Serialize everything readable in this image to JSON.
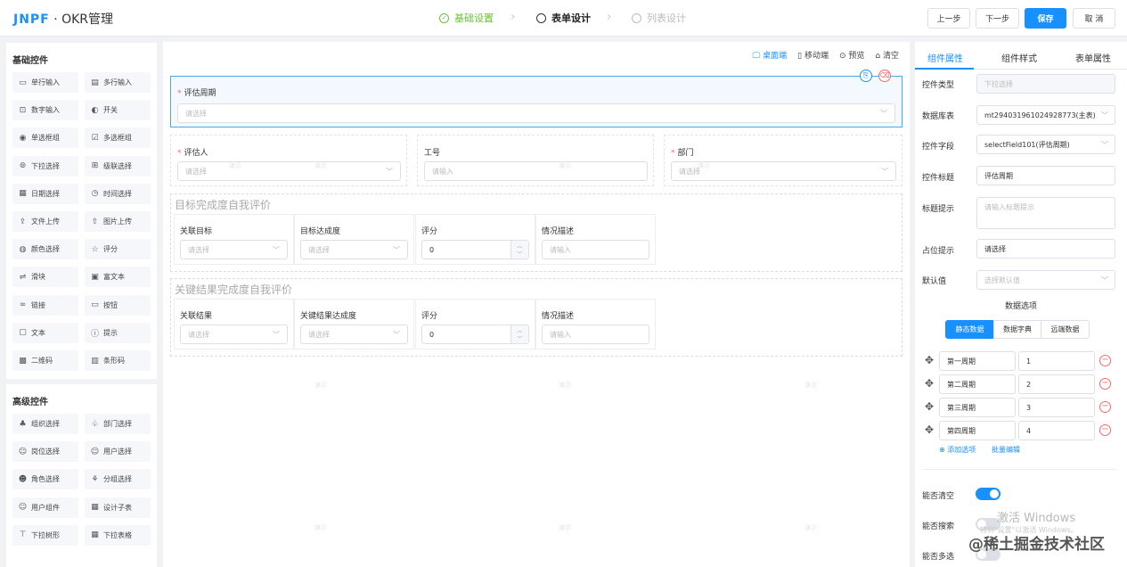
{
  "header": {
    "logo_brand": "JNPF",
    "logo_sep": "·",
    "title": "OKR管理",
    "steps": [
      {
        "label": "基础设置",
        "state": "done"
      },
      {
        "label": "表单设计",
        "state": "active"
      },
      {
        "label": "列表设计",
        "state": "todo"
      }
    ],
    "buttons": {
      "prev": "上一步",
      "next": "下一步",
      "save": "保存",
      "cancel": "取 消"
    }
  },
  "basic_controls": {
    "title": "基础控件",
    "items": [
      {
        "label": "单行输入",
        "icon": "input-icon"
      },
      {
        "label": "多行输入",
        "icon": "textarea-icon"
      },
      {
        "label": "数字输入",
        "icon": "number-icon"
      },
      {
        "label": "开关",
        "icon": "switch-icon"
      },
      {
        "label": "单选框组",
        "icon": "radio-icon"
      },
      {
        "label": "多选框组",
        "icon": "checkbox-icon"
      },
      {
        "label": "下拉选择",
        "icon": "select-icon"
      },
      {
        "label": "级联选择",
        "icon": "cascader-icon"
      },
      {
        "label": "日期选择",
        "icon": "calendar-icon"
      },
      {
        "label": "时间选择",
        "icon": "clock-icon"
      },
      {
        "label": "文件上传",
        "icon": "upload-icon"
      },
      {
        "label": "图片上传",
        "icon": "image-upload-icon"
      },
      {
        "label": "颜色选择",
        "icon": "palette-icon"
      },
      {
        "label": "评分",
        "icon": "star-icon"
      },
      {
        "label": "滑块",
        "icon": "slider-icon"
      },
      {
        "label": "富文本",
        "icon": "richtext-icon"
      },
      {
        "label": "链接",
        "icon": "link-icon"
      },
      {
        "label": "按钮",
        "icon": "button-icon"
      },
      {
        "label": "文本",
        "icon": "text-icon"
      },
      {
        "label": "提示",
        "icon": "alert-icon"
      },
      {
        "label": "二维码",
        "icon": "qrcode-icon"
      },
      {
        "label": "条形码",
        "icon": "barcode-icon"
      }
    ]
  },
  "advanced_controls": {
    "title": "高级控件",
    "items": [
      {
        "label": "组织选择",
        "icon": "org-icon"
      },
      {
        "label": "部门选择",
        "icon": "dept-icon"
      },
      {
        "label": "岗位选择",
        "icon": "position-icon"
      },
      {
        "label": "用户选择",
        "icon": "user-icon"
      },
      {
        "label": "角色选择",
        "icon": "role-icon"
      },
      {
        "label": "分组选择",
        "icon": "group-icon"
      },
      {
        "label": "用户组件",
        "icon": "user-comp-icon"
      },
      {
        "label": "设计子表",
        "icon": "table-icon"
      },
      {
        "label": "下拉树形",
        "icon": "tree-icon"
      },
      {
        "label": "下拉表格",
        "icon": "dropdown-table-icon"
      }
    ]
  },
  "canvas_toolbar": {
    "desktop": "桌面端",
    "mobile": "移动端",
    "preview": "预览",
    "clear": "清空"
  },
  "form": {
    "cycle": {
      "label": "评估周期",
      "placeholder": "请选择"
    },
    "assessor": {
      "label": "评估人",
      "placeholder": "请选择"
    },
    "employee_no": {
      "label": "工号",
      "placeholder": "请输入"
    },
    "department": {
      "label": "部门",
      "placeholder": "请选择"
    },
    "section1": {
      "title": "目标完成度自我评价",
      "cols": [
        {
          "label": "关联目标",
          "placeholder": "请选择",
          "kind": "select"
        },
        {
          "label": "目标达成度",
          "placeholder": "请选择",
          "kind": "select"
        },
        {
          "label": "评分",
          "value": "0",
          "kind": "number"
        },
        {
          "label": "情况描述",
          "placeholder": "请输入",
          "kind": "input"
        }
      ]
    },
    "section2": {
      "title": "关键结果完成度自我评价",
      "cols": [
        {
          "label": "关联结果",
          "placeholder": "请选择",
          "kind": "select"
        },
        {
          "label": "关键结果达成度",
          "placeholder": "请选择",
          "kind": "select"
        },
        {
          "label": "评分",
          "value": "0",
          "kind": "number"
        },
        {
          "label": "情况描述",
          "placeholder": "请输入",
          "kind": "input"
        }
      ]
    },
    "watermark": "演示"
  },
  "props_panel": {
    "tabs": [
      "组件属性",
      "组件样式",
      "表单属性"
    ],
    "fields": {
      "type": {
        "label": "控件类型",
        "value": "下拉选择"
      },
      "table": {
        "label": "数据库表",
        "value": "mt294031961024928773(主表)"
      },
      "field": {
        "label": "控件字段",
        "value": "selectField101(评估周期)"
      },
      "title": {
        "label": "控件标题",
        "value": "评估周期"
      },
      "tip": {
        "label": "标题提示",
        "placeholder": "请输入标题提示"
      },
      "placeholder": {
        "label": "占位提示",
        "value": "请选择"
      },
      "default": {
        "label": "默认值",
        "placeholder": "选择默认值"
      }
    },
    "options_title": "数据选项",
    "source_tabs": [
      "静态数据",
      "数据字典",
      "远端数据"
    ],
    "options": [
      {
        "label": "第一周期",
        "value": "1"
      },
      {
        "label": "第二周期",
        "value": "2"
      },
      {
        "label": "第三周期",
        "value": "3"
      },
      {
        "label": "第四周期",
        "value": "4"
      }
    ],
    "add_option": "添加选项",
    "batch_edit": "批量编辑",
    "switches": [
      {
        "label": "能否清空",
        "on": true
      },
      {
        "label": "能否搜索",
        "on": false
      },
      {
        "label": "能否多选",
        "on": false
      }
    ]
  },
  "overlay": {
    "activate_title": "激活 Windows",
    "activate_sub": "转到\"设置\"以激活 Windows。",
    "credit": "@稀土掘金技术社区"
  }
}
